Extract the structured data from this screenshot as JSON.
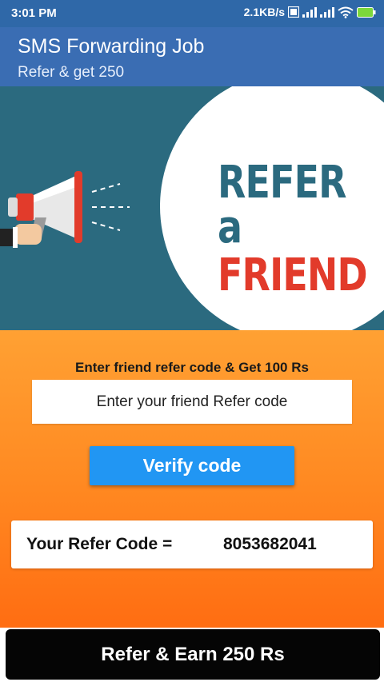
{
  "status_bar": {
    "time": "3:01 PM",
    "network_speed": "2.1KB/s",
    "icons": [
      "hd-volte-icon",
      "signal-icon",
      "signal-icon",
      "wifi-icon",
      "battery-icon"
    ]
  },
  "app_bar": {
    "title": "SMS Forwarding Job",
    "subtitle": "Refer & get 250"
  },
  "banner": {
    "line1": "REFER a",
    "line2": "FRIEND",
    "icon": "megaphone-icon",
    "colors": {
      "background": "#2b6a7f",
      "refer": "#2b6a7f",
      "friend": "#e23b2b"
    }
  },
  "form": {
    "heading": "Enter friend refer code & Get 100 Rs",
    "input_placeholder": "Enter your friend Refer code",
    "input_value": "",
    "verify_label": "Verify code"
  },
  "refer_code": {
    "label": "Your Refer Code =",
    "value": "8053682041"
  },
  "bottom_button": {
    "label": "Refer & Earn 250 Rs"
  },
  "colors": {
    "status_bar": "#2f68a8",
    "app_bar": "#3a6db3",
    "content_gradient_top": "#ffa133",
    "content_gradient_bottom": "#ff6d12",
    "verify_button": "#2196f3",
    "bottom_button": "#050505"
  }
}
